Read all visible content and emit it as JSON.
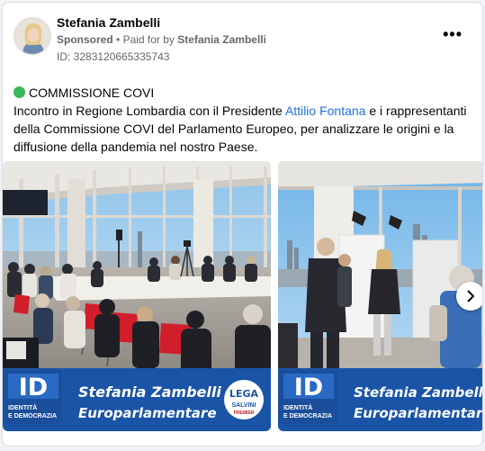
{
  "post": {
    "author_name": "Stefania Zambelli",
    "sponsored_label": "Sponsored",
    "separator": "•",
    "paid_for_prefix": "Paid for by",
    "paid_for_name": "Stefania Zambelli",
    "ad_id": "ID: 3283120665335743",
    "more_label": "•••"
  },
  "text": {
    "headline": "COMMISSIONE COVI",
    "body_part1": "Incontro in Regione Lombardia con il Presidente ",
    "body_link": "Attilio Fontana",
    "body_part2": " e i rappresentanti della Commissione COVI del Parlamento Europeo, per analizzare le origini e la diffusione della pandemia nel nostro Paese."
  },
  "banner": {
    "logo_letters": "ID",
    "logo_caption_line1": "IDENTITÀ",
    "logo_caption_line2": "E DEMOCRAZIA",
    "name_line": "Stefania Zambelli",
    "role_line": "Europarlamentare",
    "party_logo_top": "LEGA",
    "party_logo_bottom": "SALVINI",
    "party_logo_sub": "PREMIER"
  },
  "colors": {
    "banner_blue": "#1a54a6",
    "status_green": "#3bb75e",
    "link_blue": "#216fdb"
  },
  "icons": {
    "status": "green-circle-icon",
    "more": "more-options-icon",
    "next": "chevron-right-icon"
  }
}
